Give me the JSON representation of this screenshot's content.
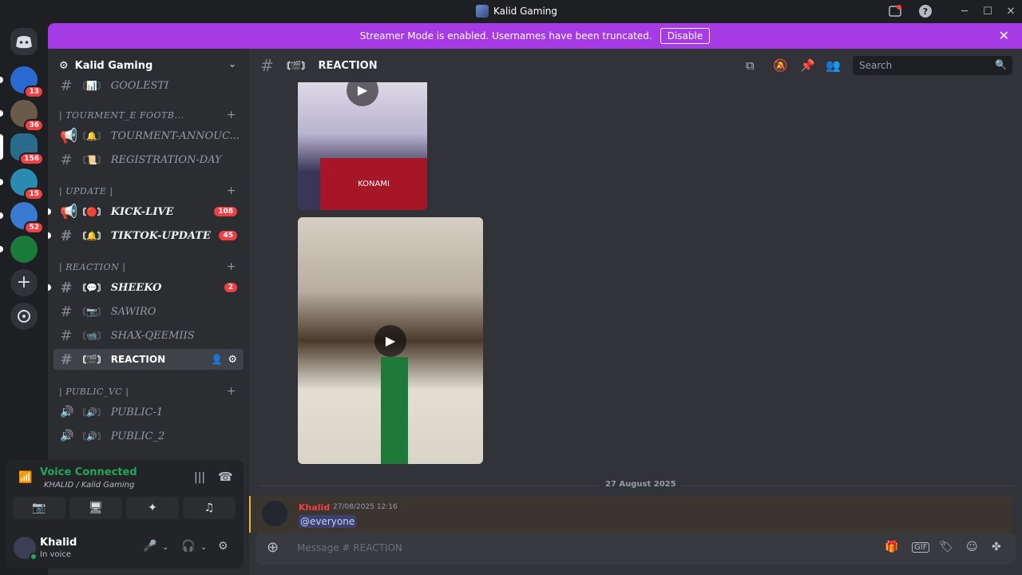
{
  "titlebar": {
    "title": "Kalid Gaming"
  },
  "banner": {
    "message": "Streamer Mode is enabled. Usernames have been truncated.",
    "action": "Disable"
  },
  "servers": [
    {
      "badge": "13",
      "color": "#2a6ad0"
    },
    {
      "badge": "36",
      "color": "#6a5a4a"
    },
    {
      "badge": "156",
      "color": "#2a6a8a"
    },
    {
      "badge": "15",
      "color": "#2a8ab0"
    },
    {
      "badge": "52",
      "color": "#3a7ad0"
    },
    {
      "badge": "",
      "color": "#1a7a3a"
    }
  ],
  "sidebar": {
    "guild_name": "Kalid Gaming",
    "channels": {
      "goolesti": "GOOLESTI",
      "cat_tourment": "| TOURMENT_E FOOTB...",
      "tourment_annouc": "TOURMENT-ANNOUC...",
      "registration_day": "REGISTRATION-DAY",
      "cat_update": "| UPDATE |",
      "kick_live": "KICK-LIVE",
      "kick_live_count": "108",
      "tiktok_update": "TIKTOK-UPDATE",
      "tiktok_update_count": "45",
      "cat_reaction": "| REACTION |",
      "sheeko": "SHEEKO",
      "sheeko_count": "2",
      "sawiro": "SAWIRO",
      "shax_qeemiis": "SHAX-QEEMIIS",
      "reaction": "REACTION",
      "cat_public_vc": "| PUBLIC_VC |",
      "public_1": "PUBLIC-1",
      "public_2": "PUBLIC_2"
    }
  },
  "voice": {
    "status": "Voice Connected",
    "channel": "KHALID / Kalid Gaming"
  },
  "user": {
    "name": "Khalid",
    "status": "In voice"
  },
  "channel_header": {
    "name": "REACTION",
    "search_placeholder": "Search"
  },
  "media": {
    "sponsor": "KONAMI"
  },
  "messages": {
    "date_divider": "27 August 2025",
    "author": "Khalid",
    "timestamp": "27/08/2025 12:16",
    "content": "@everyone"
  },
  "composer": {
    "placeholder": "Message # REACTION"
  }
}
